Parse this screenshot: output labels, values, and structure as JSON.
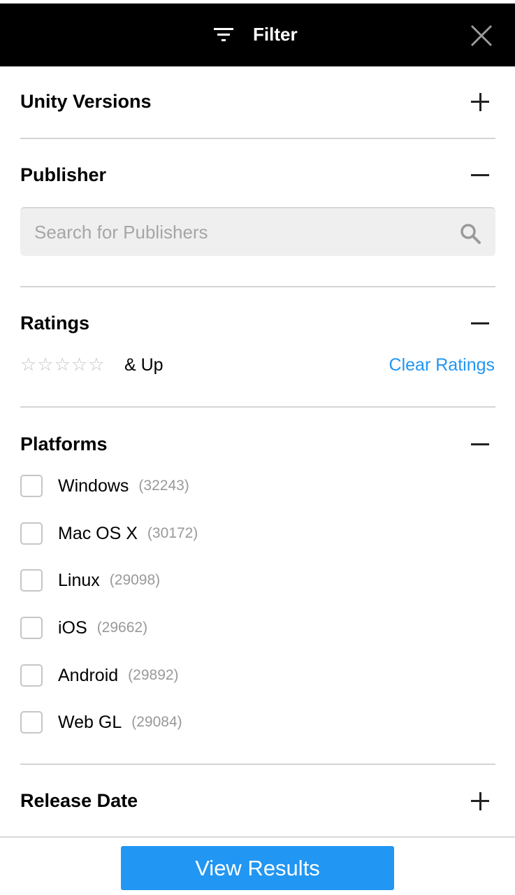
{
  "header": {
    "title": "Filter",
    "filter_icon": "filter-icon",
    "close_icon": "close-icon"
  },
  "sections": {
    "unity_versions": {
      "title": "Unity Versions",
      "state": "collapsed"
    },
    "publisher": {
      "title": "Publisher",
      "state": "expanded",
      "search_placeholder": "Search for Publishers",
      "search_value": ""
    },
    "ratings": {
      "title": "Ratings",
      "state": "expanded",
      "stars": "☆☆☆☆☆",
      "selected_stars": 0,
      "suffix": "& Up",
      "clear_label": "Clear Ratings"
    },
    "platforms": {
      "title": "Platforms",
      "state": "expanded",
      "items": [
        {
          "label": "Windows",
          "count": "(32243)",
          "checked": false
        },
        {
          "label": "Mac OS X",
          "count": "(30172)",
          "checked": false
        },
        {
          "label": "Linux",
          "count": "(29098)",
          "checked": false
        },
        {
          "label": "iOS",
          "count": "(29662)",
          "checked": false
        },
        {
          "label": "Android",
          "count": "(29892)",
          "checked": false
        },
        {
          "label": "Web GL",
          "count": "(29084)",
          "checked": false
        }
      ]
    },
    "release_date": {
      "title": "Release Date",
      "state": "collapsed"
    }
  },
  "footer": {
    "button_label": "View Results"
  },
  "colors": {
    "accent": "#2196f3",
    "header_bg": "#000000"
  }
}
